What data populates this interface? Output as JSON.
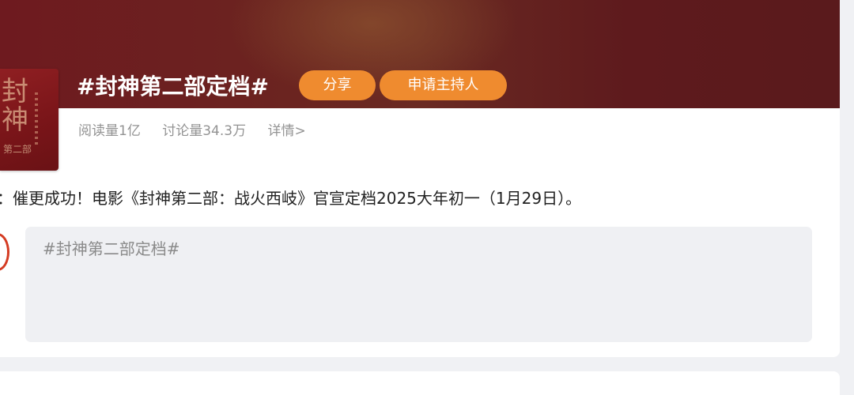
{
  "topic": {
    "title": "#封神第二部定档#",
    "share_label": "分享",
    "host_label": "申请主持人",
    "cover": {
      "char1": "封",
      "char2": "神",
      "char3": "第二部"
    }
  },
  "stats": {
    "reads": "阅读量1亿",
    "discussions": "讨论量34.3万",
    "detail_link": "详情>"
  },
  "lead_text": "：催更成功！电影《封神第二部：战火西岐》官宣定档2025大年初一（1月29日）。",
  "composer": {
    "value": "#封神第二部定档#"
  },
  "colors": {
    "banner": "#6b2420",
    "accent_orange": "#ef8b2f",
    "input_bg": "#eff0f3"
  }
}
